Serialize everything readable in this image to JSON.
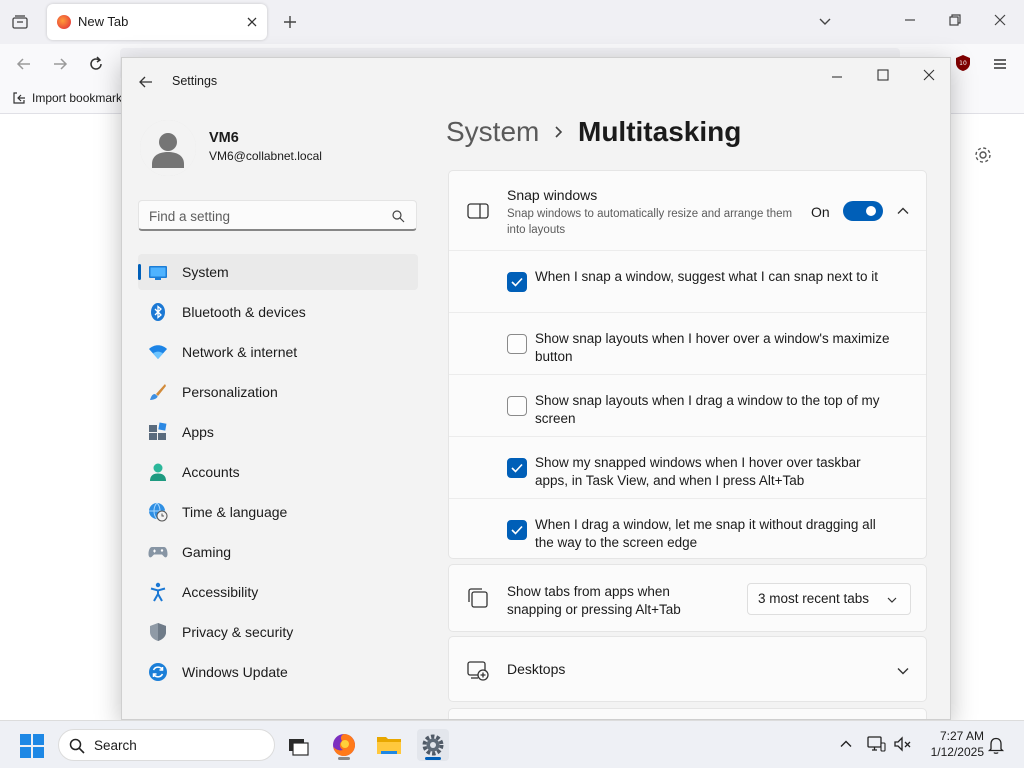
{
  "browser": {
    "tab_title": "New Tab",
    "bookmarks": {
      "import_label": "Import bookmarks..."
    }
  },
  "window": {
    "title": "Settings"
  },
  "profile": {
    "name": "VM6",
    "email": "VM6@collabnet.local"
  },
  "search": {
    "placeholder": "Find a setting"
  },
  "nav": {
    "items": [
      {
        "label": "System",
        "icon": "system-icon",
        "active": true
      },
      {
        "label": "Bluetooth & devices",
        "icon": "bluetooth-icon"
      },
      {
        "label": "Network & internet",
        "icon": "wifi-icon"
      },
      {
        "label": "Personalization",
        "icon": "brush-icon"
      },
      {
        "label": "Apps",
        "icon": "apps-icon"
      },
      {
        "label": "Accounts",
        "icon": "person-icon"
      },
      {
        "label": "Time & language",
        "icon": "globe-clock-icon"
      },
      {
        "label": "Gaming",
        "icon": "gamepad-icon"
      },
      {
        "label": "Accessibility",
        "icon": "accessibility-icon"
      },
      {
        "label": "Privacy & security",
        "icon": "shield-icon"
      },
      {
        "label": "Windows Update",
        "icon": "update-icon"
      }
    ]
  },
  "breadcrumb": {
    "parent": "System",
    "current": "Multitasking"
  },
  "snap": {
    "title": "Snap windows",
    "description": "Snap windows to automatically resize and arrange them into layouts",
    "state_label": "On",
    "enabled": true,
    "options": [
      {
        "label": "When I snap a window, suggest what I can snap next to it",
        "checked": true
      },
      {
        "label": "Show snap layouts when I hover over a window's maximize button",
        "checked": false
      },
      {
        "label": "Show snap layouts when I drag a window to the top of my screen",
        "checked": false
      },
      {
        "label": "Show my snapped windows when I hover over taskbar apps, in Task View, and when I press Alt+Tab",
        "checked": true
      },
      {
        "label": "When I drag a window, let me snap it without dragging all the way to the screen edge",
        "checked": true
      }
    ]
  },
  "tabs_setting": {
    "label": "Show tabs from apps when snapping or pressing Alt+Tab",
    "selected": "3 most recent tabs"
  },
  "desktops": {
    "label": "Desktops"
  },
  "taskbar": {
    "search_label": "Search",
    "time": "7:27 AM",
    "date": "1/12/2025",
    "apps": [
      "task-view-icon",
      "firefox-icon",
      "file-explorer-icon",
      "settings-icon"
    ]
  },
  "colors": {
    "accent": "#005fb8",
    "window_bg": "#f3f3f3",
    "card_bg": "#fbfbfb",
    "taskbar_bg": "#eef0f5"
  }
}
